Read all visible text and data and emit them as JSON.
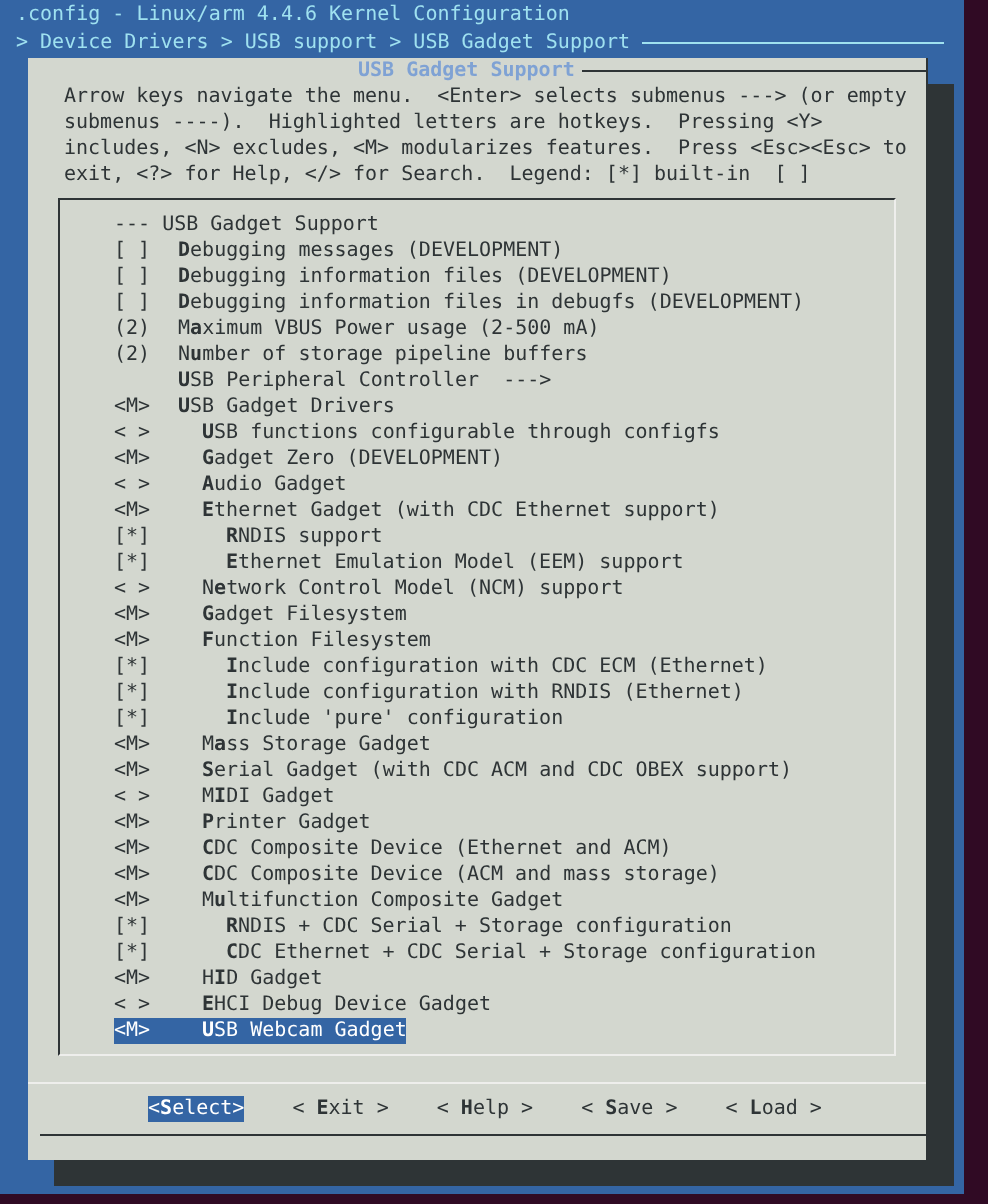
{
  "window": {
    "title": ".config - Linux/arm 4.4.6 Kernel Configuration"
  },
  "breadcrumb": "> Device Drivers > USB support > USB Gadget Support",
  "dialog": {
    "title": "USB Gadget Support",
    "help": "Arrow keys navigate the menu.  <Enter> selects submenus ---> (or empty submenus ----).  Highlighted letters are hotkeys.  Pressing <Y> includes, <N> excludes, <M> modularizes features.  Press <Esc><Esc> to exit, <?> for Help, </> for Search.  Legend: [*] built-in  [ ]",
    "items": [
      {
        "kind": "header",
        "mark": "---",
        "label": "USB Gadget Support",
        "selected": false
      },
      {
        "kind": "option",
        "mark": "[ ]",
        "label": "**D**ebugging messages (DEVELOPMENT)",
        "selected": false
      },
      {
        "kind": "option",
        "mark": "[ ]",
        "label": "**D**ebugging information files (DEVELOPMENT)",
        "selected": false
      },
      {
        "kind": "option",
        "mark": "[ ]",
        "label": "**D**ebugging information files in debugfs (DEVELOPMENT)",
        "selected": false
      },
      {
        "kind": "option",
        "mark": "(2)",
        "label": "M**a**ximum VBUS Power usage (2-500 mA)",
        "selected": false
      },
      {
        "kind": "option",
        "mark": "(2)",
        "label": "N**u**mber of storage pipeline buffers",
        "selected": false
      },
      {
        "kind": "option",
        "label": "**U**SB Peripheral Controller",
        "submenu": "--->",
        "selected": false
      },
      {
        "kind": "option",
        "mark": "<M>",
        "label": "**U**SB Gadget Drivers",
        "selected": false,
        "children": [
          {
            "kind": "option",
            "mark": "< >",
            "label": "**U**SB functions configurable through configfs",
            "selected": false
          },
          {
            "kind": "option",
            "mark": "<M>",
            "label": "**G**adget Zero (DEVELOPMENT)",
            "selected": false
          },
          {
            "kind": "option",
            "mark": "< >",
            "label": "**A**udio Gadget",
            "selected": false
          },
          {
            "kind": "option",
            "mark": "<M>",
            "label": "**E**thernet Gadget (with CDC Ethernet support)",
            "selected": false,
            "children": [
              {
                "kind": "option",
                "mark": "[*]",
                "label": "**R**NDIS support",
                "selected": false
              },
              {
                "kind": "option",
                "mark": "[*]",
                "label": "**E**thernet Emulation Model (EEM) support",
                "selected": false
              }
            ]
          },
          {
            "kind": "option",
            "mark": "< >",
            "label": "N**e**twork Control Model (NCM) support",
            "selected": false
          },
          {
            "kind": "option",
            "mark": "<M>",
            "label": "**G**adget Filesystem",
            "selected": false
          },
          {
            "kind": "option",
            "mark": "<M>",
            "label": "**F**unction Filesystem",
            "selected": false,
            "children": [
              {
                "kind": "option",
                "mark": "[*]",
                "label": "**I**nclude configuration with CDC ECM (Ethernet)",
                "selected": false
              },
              {
                "kind": "option",
                "mark": "[*]",
                "label": "**I**nclude configuration with RNDIS (Ethernet)",
                "selected": false
              },
              {
                "kind": "option",
                "mark": "[*]",
                "label": "**I**nclude 'pure' configuration",
                "selected": false
              }
            ]
          },
          {
            "kind": "option",
            "mark": "<M>",
            "label": "M**a**ss Storage Gadget",
            "selected": false
          },
          {
            "kind": "option",
            "mark": "<M>",
            "label": "**S**erial Gadget (with CDC ACM and CDC OBEX support)",
            "selected": false
          },
          {
            "kind": "option",
            "mark": "< >",
            "label": "M**I**DI Gadget",
            "selected": false
          },
          {
            "kind": "option",
            "mark": "<M>",
            "label": "**P**rinter Gadget",
            "selected": false
          },
          {
            "kind": "option",
            "mark": "<M>",
            "label": "**C**DC Composite Device (Ethernet and ACM)",
            "selected": false
          },
          {
            "kind": "option",
            "mark": "<M>",
            "label": "**C**DC Composite Device (ACM and mass storage)",
            "selected": false
          },
          {
            "kind": "option",
            "mark": "<M>",
            "label": "M**u**ltifunction Composite Gadget",
            "selected": false,
            "children": [
              {
                "kind": "option",
                "mark": "[*]",
                "label": "**R**NDIS + CDC Serial + Storage configuration",
                "selected": false
              },
              {
                "kind": "option",
                "mark": "[*]",
                "label": "**C**DC Ethernet + CDC Serial + Storage configuration",
                "selected": false
              }
            ]
          },
          {
            "kind": "option",
            "mark": "<M>",
            "label": "H**I**D Gadget",
            "selected": false
          },
          {
            "kind": "option",
            "mark": "< >",
            "label": "**E**HCI Debug Device Gadget",
            "selected": false
          },
          {
            "kind": "option",
            "mark": "<M>",
            "label": "**U**SB Webcam Gadget",
            "selected": true
          }
        ]
      }
    ],
    "buttons": [
      {
        "label": "<**S**elect>",
        "selected": true
      },
      {
        "label": "< **E**xit >",
        "selected": false
      },
      {
        "label": "< **H**elp >",
        "selected": false
      },
      {
        "label": "< **S**ave >",
        "selected": false
      },
      {
        "label": "< **L**oad >",
        "selected": false
      }
    ]
  }
}
